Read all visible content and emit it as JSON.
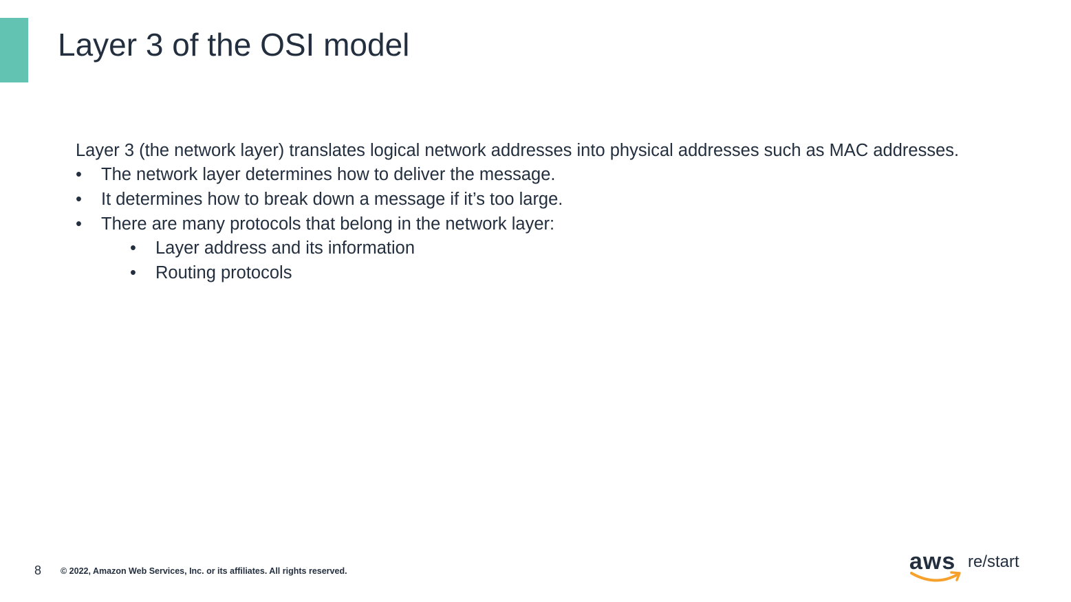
{
  "colors": {
    "accent": "#63c3b2",
    "text": "#232f3e",
    "brand_orange": "#f5a12b"
  },
  "slide": {
    "title": "Layer 3 of the OSI model",
    "intro": "Layer 3 (the network layer) translates logical network addresses into physical addresses such as MAC addresses.",
    "bullets": [
      "The network layer determines how to deliver the message.",
      "It determines how to break down a message if it’s too large.",
      "There are many protocols that belong in the network layer:"
    ],
    "sub_bullets": [
      "Layer address and its information",
      "Routing protocols"
    ],
    "bullet_glyph": "•"
  },
  "footer": {
    "page_number": "8",
    "copyright": "© 2022, Amazon Web Services, Inc. or its affiliates. All rights reserved."
  },
  "logo": {
    "brand": "aws",
    "product": "re/start",
    "icon": "amazon-smile-arrow-icon"
  }
}
